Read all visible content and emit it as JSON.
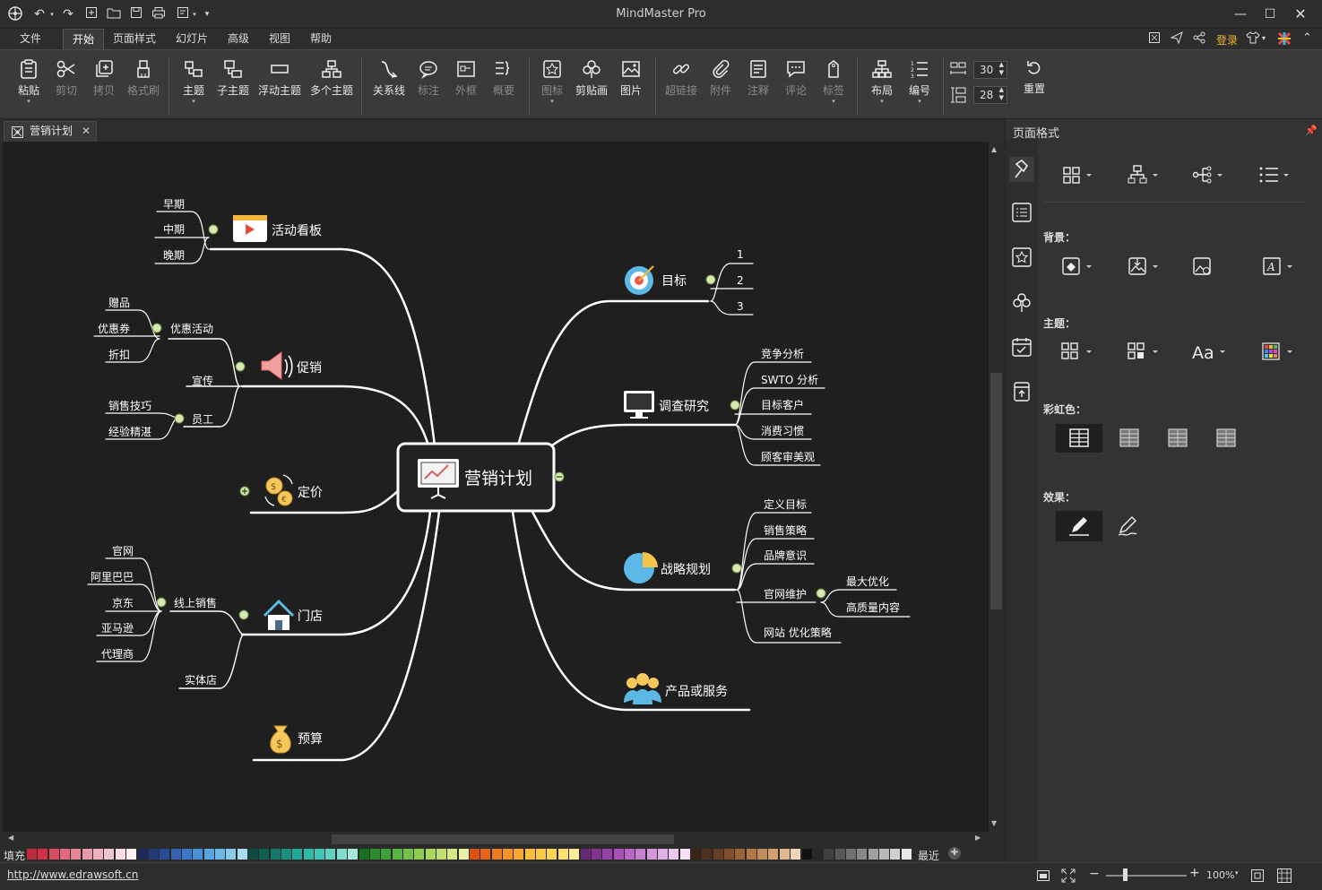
{
  "app": {
    "title": "MindMaster Pro"
  },
  "menu": {
    "items": [
      "文件",
      "开始",
      "页面样式",
      "幻灯片",
      "高级",
      "视图",
      "帮助"
    ],
    "login": "登录"
  },
  "ribbon": {
    "paste": "粘贴",
    "cut": "剪切",
    "copy": "拷贝",
    "format_brush": "格式刷",
    "topic": "主题",
    "subtopic": "子主题",
    "floating_topic": "浮动主题",
    "multi_topic": "多个主题",
    "relationship": "关系线",
    "callout": "标注",
    "boundary": "外框",
    "summary": "概要",
    "icon": "图标",
    "clipart": "剪贴画",
    "image": "图片",
    "hyperlink": "超链接",
    "attachment": "附件",
    "note": "注释",
    "comment": "评论",
    "tag": "标签",
    "layout": "布局",
    "numbering": "编号",
    "h_spacing": "30",
    "v_spacing": "28",
    "reset": "重置"
  },
  "tab": {
    "name": "营销计划"
  },
  "mindmap": {
    "central": "营销计划",
    "branches": {
      "activity_board": {
        "label": "活动看板",
        "children": [
          "早期",
          "中期",
          "晚期"
        ]
      },
      "promotion": {
        "label": "促销",
        "promo_activity": "优惠活动",
        "promo_children": [
          "赠品",
          "优惠券",
          "折扣"
        ],
        "publicity": "宣传",
        "staff": "员工",
        "staff_children": [
          "销售技巧",
          "经验精湛"
        ]
      },
      "pricing": {
        "label": "定价"
      },
      "store": {
        "label": "门店",
        "online": "线上销售",
        "online_children": [
          "官网",
          "阿里巴巴",
          "京东",
          "亚马逊",
          "代理商"
        ],
        "physical": "实体店"
      },
      "budget": {
        "label": "预算"
      },
      "goal": {
        "label": "目标",
        "children": [
          "1",
          "2",
          "3"
        ]
      },
      "research": {
        "label": "调查研究",
        "children": [
          "竞争分析",
          "SWTO 分析",
          "目标客户",
          "消费习惯",
          "顾客审美观"
        ]
      },
      "strategy": {
        "label": "战略规划",
        "children": [
          "定义目标",
          "销售策略",
          "品牌意识"
        ],
        "website": "官网维护",
        "website_children": [
          "最大优化",
          "高质量内容"
        ],
        "seo": "网站 优化策略"
      },
      "product": {
        "label": "产品或服务"
      }
    }
  },
  "side_panel": {
    "title": "页面格式",
    "background_label": "背景：",
    "theme_label": "主题：",
    "rainbow_label": "彩虹色：",
    "effect_label": "效果："
  },
  "colorbar": {
    "fill_label": "填充",
    "recent_label": "最近"
  },
  "status": {
    "url": "http://www.edrawsoft.cn",
    "zoom": "100%"
  },
  "palette": [
    "#c0283c",
    "#d03048",
    "#d84c60",
    "#e06880",
    "#e48494",
    "#e898a8",
    "#eeb0bc",
    "#f0c4cc",
    "#f8dde2",
    "#fff0f3",
    "#1c2a5a",
    "#223a78",
    "#2a4c96",
    "#3462b0",
    "#3c78c8",
    "#4890d8",
    "#58a4e0",
    "#6cb8e8",
    "#88cce8",
    "#a8dcf0",
    "#0c4c40",
    "#106050",
    "#147868",
    "#1a9080",
    "#20a898",
    "#30b8a8",
    "#44c4b4",
    "#60d0c0",
    "#80dccc",
    "#a8e8dc",
    "#1a7020",
    "#2a8c2c",
    "#3ca238",
    "#58b440",
    "#74c048",
    "#90cc50",
    "#a8d860",
    "#c0e070",
    "#d4e888",
    "#e8f0a8",
    "#e05010",
    "#e86418",
    "#f07c20",
    "#f49428",
    "#f8a830",
    "#fcbc3c",
    "#fcc848",
    "#fcd458",
    "#fce070",
    "#fcec98",
    "#6a2878",
    "#803490",
    "#9640a8",
    "#a850b8",
    "#b868c4",
    "#c880d0",
    "#d498da",
    "#e0b0e4",
    "#ecc8ee",
    "#f6e0f6",
    "#3a2418",
    "#50301e",
    "#684026",
    "#80502e",
    "#986438",
    "#b07844",
    "#c08c58",
    "#d0a070",
    "#e0b890",
    "#f0d4b8",
    "#101010",
    "#282828",
    "#404040",
    "#585858",
    "#707070",
    "#888888",
    "#a0a0a0",
    "#b8b8b8",
    "#d0d0d0",
    "#e8e8e8"
  ]
}
